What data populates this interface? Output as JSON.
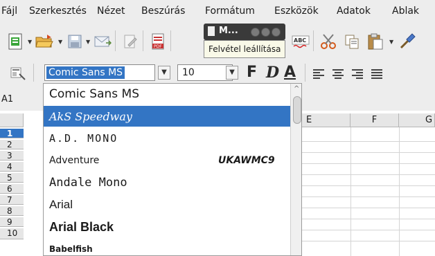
{
  "menubar": {
    "items": [
      "Fájl",
      "Szerkesztés",
      "Nézet",
      "Beszúrás",
      "Formátum",
      "Eszközök",
      "Adatok",
      "Ablak"
    ]
  },
  "mini_window": {
    "title": "M...",
    "tooltip": "Felvétel leállítása"
  },
  "formatting": {
    "font_name": "Comic Sans MS",
    "font_size": "10",
    "bold_label": "F",
    "italic_label": "D",
    "underline_label": "A"
  },
  "namebox": {
    "value": "A1"
  },
  "sheet": {
    "columns": [
      "E",
      "F",
      "G"
    ],
    "rows": [
      "1",
      "2",
      "3",
      "4",
      "5",
      "6",
      "7",
      "8",
      "9",
      "10"
    ]
  },
  "font_list": {
    "items": [
      {
        "name": "Comic Sans MS",
        "preview": ""
      },
      {
        "name": "AkS Speedway",
        "preview": ""
      },
      {
        "name": "A.D. MONO",
        "preview": ""
      },
      {
        "name": "Adventure",
        "preview": "UKAWMC9"
      },
      {
        "name": "Andale Mono",
        "preview": ""
      },
      {
        "name": "Arial",
        "preview": ""
      },
      {
        "name": "Arial Black",
        "preview": ""
      },
      {
        "name": "Babelfish",
        "preview": ""
      }
    ],
    "selected_index": 1
  },
  "colors": {
    "accent": "#3375c4",
    "toolbar_bg": "#ededed",
    "mini_window_bg": "#3a3a3a"
  }
}
